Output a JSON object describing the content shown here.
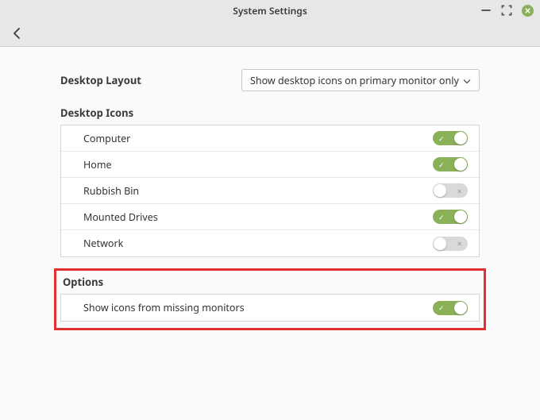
{
  "window": {
    "title": "System Settings"
  },
  "layout": {
    "label": "Desktop Layout",
    "select_value": "Show desktop icons on primary monitor only"
  },
  "icons_section": {
    "heading": "Desktop Icons",
    "rows": [
      {
        "label": "Computer",
        "on": true
      },
      {
        "label": "Home",
        "on": true
      },
      {
        "label": "Rubbish Bin",
        "on": false
      },
      {
        "label": "Mounted Drives",
        "on": true
      },
      {
        "label": "Network",
        "on": false
      }
    ]
  },
  "options_section": {
    "heading": "Options",
    "rows": [
      {
        "label": "Show icons from missing monitors",
        "on": true
      }
    ]
  }
}
